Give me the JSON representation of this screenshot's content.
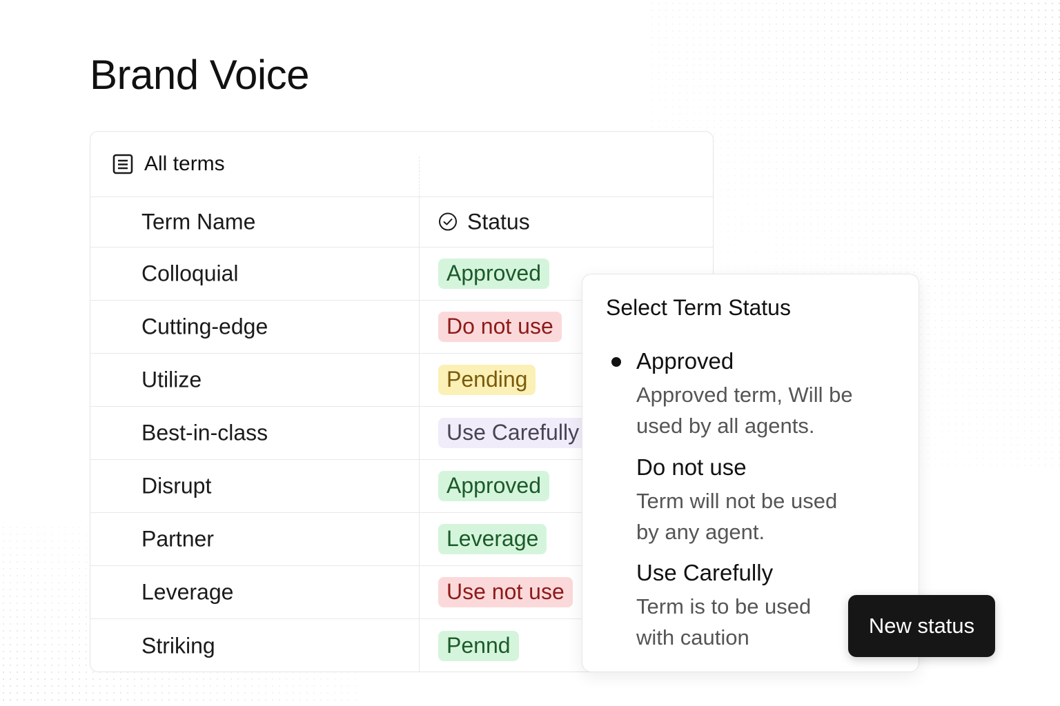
{
  "page": {
    "title": "Brand Voice"
  },
  "view": {
    "label": "All terms",
    "icon": "document-list-icon"
  },
  "table": {
    "columns": {
      "name": "Term Name",
      "status": "Status",
      "status_icon": "check-circle-icon"
    },
    "rows": [
      {
        "name": "Colloquial",
        "status": "Approved",
        "color": "green"
      },
      {
        "name": "Cutting-edge",
        "status": "Do not use",
        "color": "red"
      },
      {
        "name": "Utilize",
        "status": "Pending",
        "color": "yellow"
      },
      {
        "name": "Best-in-class",
        "status": "Use Carefully",
        "color": "purple"
      },
      {
        "name": "Disrupt",
        "status": "Approved",
        "color": "green"
      },
      {
        "name": "Partner",
        "status": "Leverage",
        "color": "green"
      },
      {
        "name": "Leverage",
        "status": "Use not use",
        "color": "red"
      },
      {
        "name": "Striking",
        "status": "Pennd",
        "color": "green"
      }
    ]
  },
  "popover": {
    "title": "Select Term Status",
    "selected": "Approved",
    "options": [
      {
        "label": "Approved",
        "desc_line1": "Approved term, Will be",
        "desc_line2": "used by all agents."
      },
      {
        "label": "Do not use",
        "desc_line1": "Term will not be used",
        "desc_line2": "by any agent."
      },
      {
        "label": "Use Carefully",
        "desc_line1": "Term is to be used",
        "desc_line2": "with caution"
      }
    ]
  },
  "actions": {
    "new_status": "New status"
  },
  "colors": {
    "green_bg": "#d4f5dc",
    "green_text": "#1c5a2a",
    "red_bg": "#fbd9da",
    "red_text": "#8e1a1a",
    "yellow_bg": "#fbf0b6",
    "yellow_text": "#7a5a0c",
    "purple_bg": "#f1ecfa",
    "purple_text": "#474454",
    "button_bg": "#161616"
  }
}
